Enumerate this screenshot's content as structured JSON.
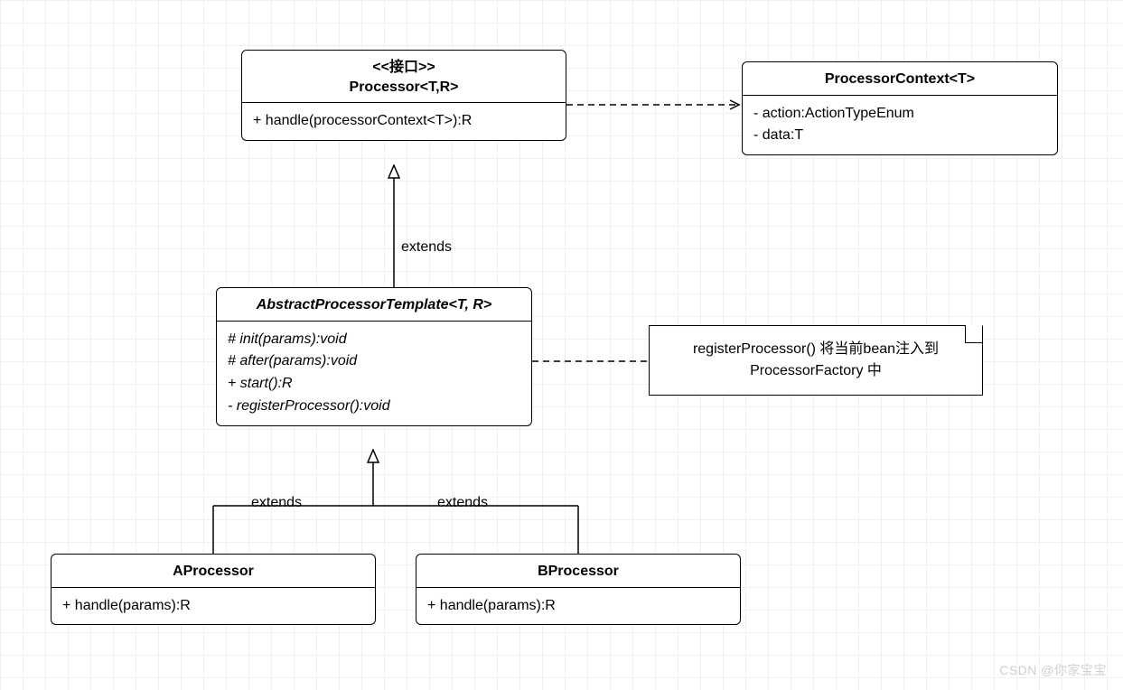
{
  "processor_interface": {
    "stereotype": "<<接口>>",
    "name": "Processor<T,R>",
    "methods": [
      "+ handle(processorContext<T>):R"
    ]
  },
  "processor_context": {
    "name": "ProcessorContext<T>",
    "fields": [
      "- action:ActionTypeEnum",
      "- data:T"
    ]
  },
  "abstract_processor_template": {
    "name": "AbstractProcessorTemplate<T, R>",
    "methods": [
      "# init(params):void",
      "# after(params):void",
      "+ start():R",
      "- registerProcessor():void"
    ]
  },
  "note": {
    "line1": "registerProcessor() 将当前bean注入到",
    "line2": "ProcessorFactory 中"
  },
  "a_processor": {
    "name": "AProcessor",
    "methods": [
      "+ handle(params):R"
    ]
  },
  "b_processor": {
    "name": "BProcessor",
    "methods": [
      "+ handle(params):R"
    ]
  },
  "labels": {
    "extends": "extends"
  },
  "watermark": "CSDN @你家宝宝"
}
